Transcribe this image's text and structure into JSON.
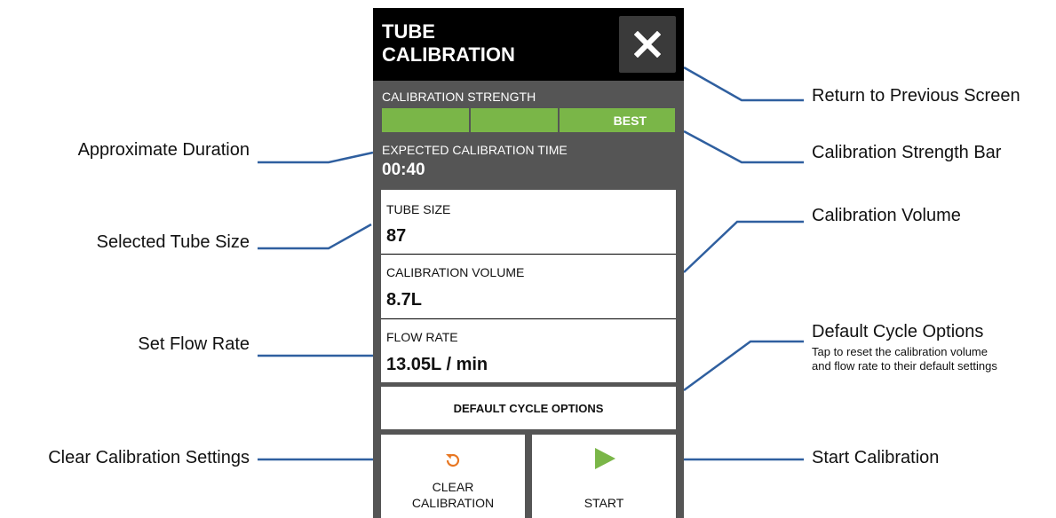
{
  "header": {
    "title_line1": "TUBE",
    "title_line2": "CALIBRATION"
  },
  "strength": {
    "label": "CALIBRATION STRENGTH",
    "level_text": "BEST",
    "level": 1.0,
    "color": "#7ab648"
  },
  "expected_time": {
    "label": "EXPECTED CALIBRATION TIME",
    "value": "00:40"
  },
  "fields": {
    "tube_size": {
      "label": "TUBE SIZE",
      "value": "87"
    },
    "calibration_volume": {
      "label": "CALIBRATION VOLUME",
      "value": "8.7L"
    },
    "flow_rate": {
      "label": "FLOW RATE",
      "value": "13.05L / min"
    }
  },
  "buttons": {
    "default_cycle": "DEFAULT CYCLE OPTIONS",
    "clear_line1": "CLEAR",
    "clear_line2": "CALIBRATION",
    "start": "START"
  },
  "callouts": {
    "return": "Return to Previous Screen",
    "strength_bar": "Calibration Strength Bar",
    "approx_duration": "Approximate Duration",
    "tube_size": "Selected Tube Size",
    "volume": "Calibration Volume",
    "flow_rate": "Set Flow Rate",
    "default_cycle": "Default Cycle Options",
    "default_cycle_desc": "Tap to reset the calibration volume and flow rate to their default settings",
    "clear": "Clear Calibration Settings",
    "start": "Start Calibration"
  },
  "icons": {
    "close": "close-icon",
    "clear": "reset-icon",
    "start": "play-icon"
  },
  "colors": {
    "accent_green": "#7ab648",
    "clear_icon": "#e87722",
    "callout_line": "#2f5f9f"
  }
}
